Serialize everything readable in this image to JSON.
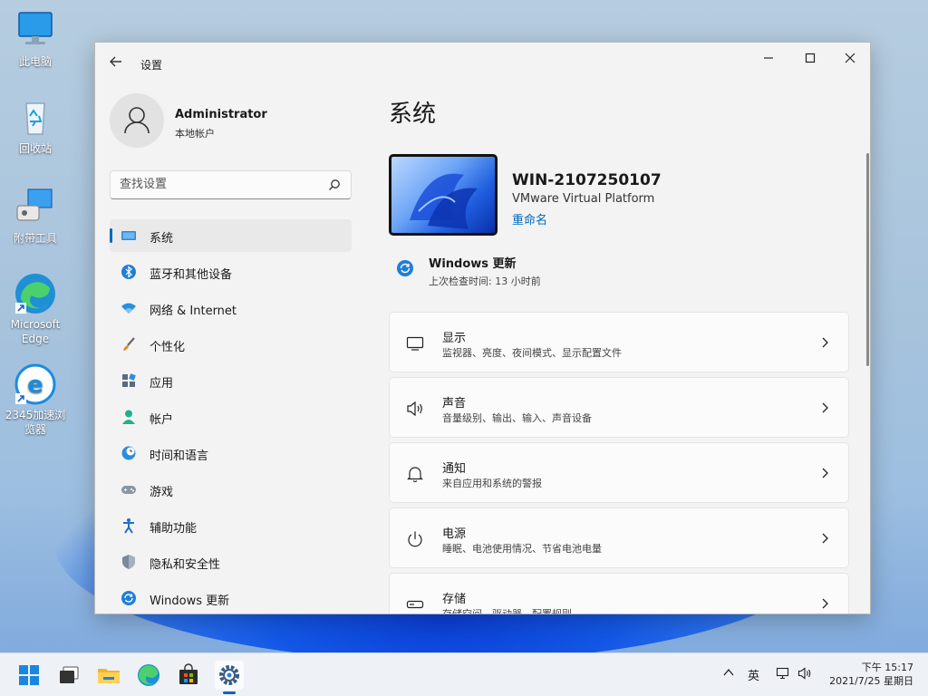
{
  "desktop": {
    "icons": [
      {
        "label": "此电脑"
      },
      {
        "label": "回收站"
      },
      {
        "label": "附带工具"
      },
      {
        "label": "Microsoft Edge"
      },
      {
        "label": "2345加速浏览器"
      }
    ]
  },
  "window": {
    "title": "设置",
    "controls": {
      "minimize": "—",
      "maximize": "☐",
      "close": "✕"
    }
  },
  "profile": {
    "name": "Administrator",
    "type": "本地帐户"
  },
  "search": {
    "placeholder": "查找设置"
  },
  "nav": {
    "items": [
      {
        "label": "系统",
        "icon": "display-icon",
        "active": true
      },
      {
        "label": "蓝牙和其他设备",
        "icon": "bluetooth-icon"
      },
      {
        "label": "网络 & Internet",
        "icon": "wifi-icon"
      },
      {
        "label": "个性化",
        "icon": "brush-icon"
      },
      {
        "label": "应用",
        "icon": "apps-icon"
      },
      {
        "label": "帐户",
        "icon": "person-icon"
      },
      {
        "label": "时间和语言",
        "icon": "globe-clock-icon"
      },
      {
        "label": "游戏",
        "icon": "gamepad-icon"
      },
      {
        "label": "辅助功能",
        "icon": "accessibility-icon"
      },
      {
        "label": "隐私和安全性",
        "icon": "shield-icon"
      },
      {
        "label": "Windows 更新",
        "icon": "update-icon"
      }
    ]
  },
  "main": {
    "title": "系统",
    "device": {
      "name": "WIN-2107250107",
      "model": "VMware Virtual Platform",
      "rename": "重命名"
    },
    "update": {
      "title": "Windows 更新",
      "subtitle": "上次检查时间: 13 小时前"
    },
    "cards": [
      {
        "title": "显示",
        "subtitle": "监视器、亮度、夜间模式、显示配置文件",
        "icon": "monitor-icon"
      },
      {
        "title": "声音",
        "subtitle": "音量级别、输出、输入、声音设备",
        "icon": "speaker-icon"
      },
      {
        "title": "通知",
        "subtitle": "来自应用和系统的警报",
        "icon": "bell-icon"
      },
      {
        "title": "电源",
        "subtitle": "睡眠、电池使用情况、节省电池电量",
        "icon": "power-icon"
      },
      {
        "title": "存储",
        "subtitle": "存储空间、驱动器、配置规则",
        "icon": "storage-icon"
      }
    ]
  },
  "taskbar": {
    "tray": {
      "chevron": "^",
      "ime": "英"
    },
    "clock": {
      "time": "下午 15:17",
      "date": "2021/7/25 星期日"
    }
  },
  "colors": {
    "accent": "#0067c0",
    "window_bg": "#f3f3f3",
    "card_bg": "#fbfbfb"
  }
}
